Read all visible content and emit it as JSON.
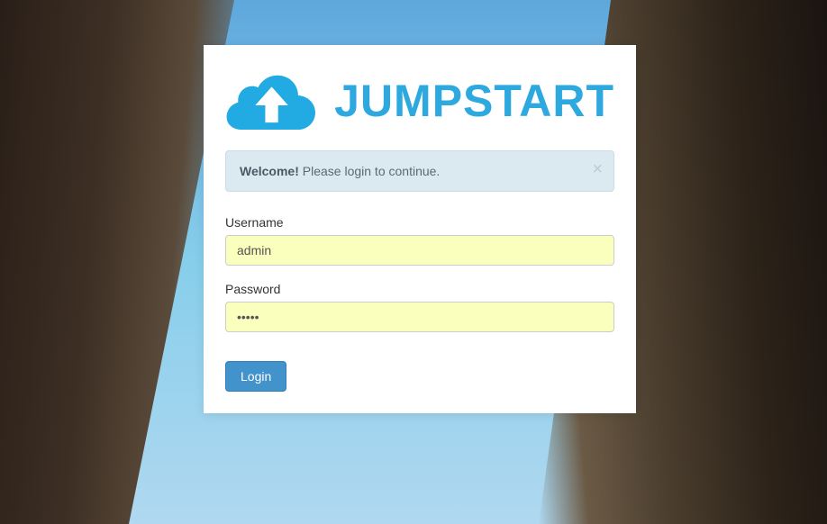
{
  "brand": {
    "name": "JUMPSTART"
  },
  "alert": {
    "strong": "Welcome!",
    "message": " Please login to continue."
  },
  "form": {
    "username": {
      "label": "Username",
      "value": "admin"
    },
    "password": {
      "label": "Password",
      "value": "•••••"
    },
    "submit": "Login"
  }
}
